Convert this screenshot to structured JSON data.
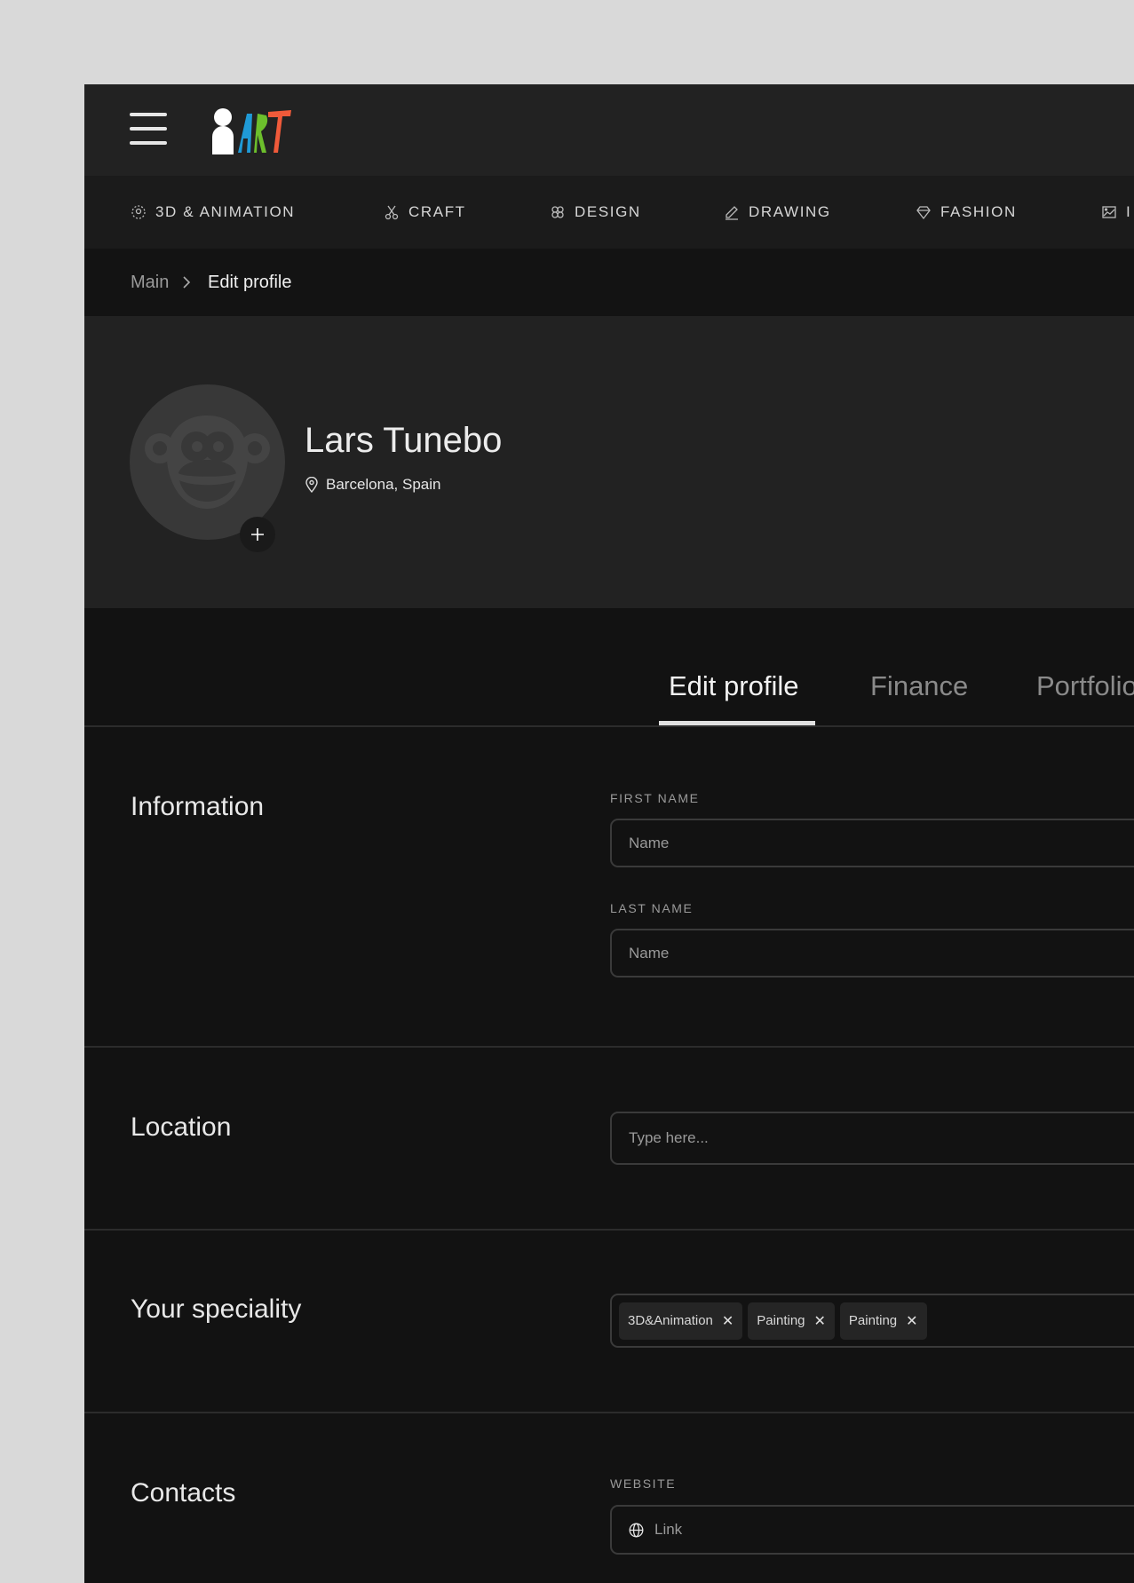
{
  "header": {
    "logo_text": "ART",
    "menu_icon": "hamburger-icon"
  },
  "nav": [
    {
      "label": "3D & ANIMATION",
      "icon": "3d-icon"
    },
    {
      "label": "CRAFT",
      "icon": "scissors-icon"
    },
    {
      "label": "DESIGN",
      "icon": "design-icon"
    },
    {
      "label": "DRAWING",
      "icon": "pencil-icon"
    },
    {
      "label": "FASHION",
      "icon": "diamond-icon"
    },
    {
      "label": "I",
      "icon": "image-icon"
    }
  ],
  "breadcrumb": {
    "root": "Main",
    "current": "Edit profile"
  },
  "profile": {
    "name": "Lars Tunebo",
    "location": "Barcelona, Spain"
  },
  "tabs": [
    {
      "label": "Edit profile",
      "active": true
    },
    {
      "label": "Finance",
      "active": false
    },
    {
      "label": "Portfolio",
      "active": false
    }
  ],
  "sections": {
    "information": {
      "title": "Information",
      "first_name_label": "FIRST NAME",
      "first_name_placeholder": "Name",
      "last_name_label": "LAST NAME",
      "last_name_placeholder": "Name"
    },
    "location": {
      "title": "Location",
      "placeholder": "Type here..."
    },
    "speciality": {
      "title": "Your speciality",
      "tags": [
        "3D&Animation",
        "Painting",
        "Painting"
      ]
    },
    "contacts": {
      "title": "Contacts",
      "website_label": "WEBSITE",
      "website_placeholder": "Link"
    }
  },
  "colors": {
    "logo_a": "#1f9ad6",
    "logo_r": "#6cbf2c",
    "logo_t": "#f05a3a",
    "panel": "#121212",
    "header": "#222222"
  }
}
